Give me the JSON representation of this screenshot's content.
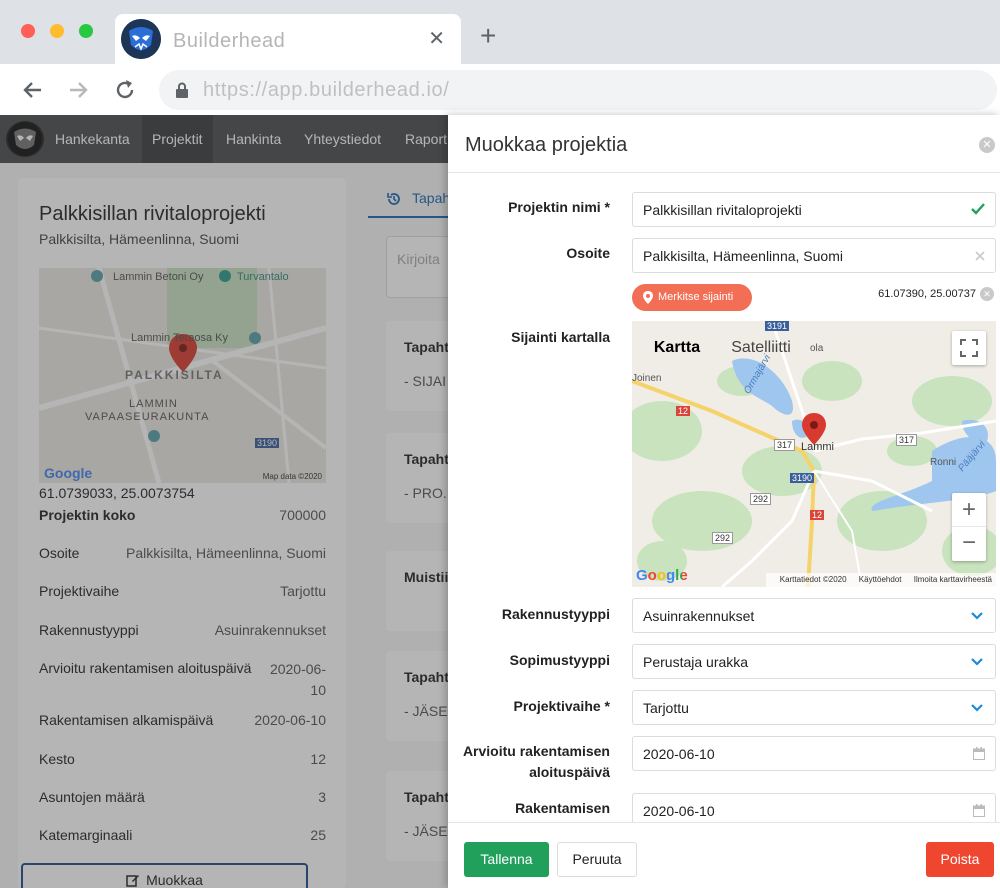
{
  "browser": {
    "tab_title": "Builderhead",
    "tab_close": "✕",
    "new_tab": "+",
    "url": "https://app.builderhead.io/"
  },
  "nav": {
    "items": [
      "Hankekanta",
      "Projektit",
      "Hankinta",
      "Yhteystiedot",
      "Raport"
    ],
    "active": "Projektit"
  },
  "left": {
    "title": "Palkkisillan rivitaloprojekti",
    "subtitle": "Palkkisilta, Hämeenlinna, Suomi",
    "map_labels": [
      "Lammin Betoni Oy",
      "Turvantalo",
      "Lammin Teraosa Ky",
      "PALKKISILTA",
      "LAMMIN",
      "VAPAASEURAKUNTA",
      "3190",
      "Map data ©2020",
      "Google"
    ],
    "coords": "61.0739033, 25.0073754",
    "details": [
      {
        "label": "Projektin koko",
        "value": "700000"
      },
      {
        "label": "Osoite",
        "value": "Palkkisilta, Hämeenlinna, Suomi"
      },
      {
        "label": "Projektivaihe",
        "value": "Tarjottu"
      },
      {
        "label": "Rakennustyyppi",
        "value": "Asuinrakennukset"
      },
      {
        "label": "Arvioitu rakentamisen aloituspäivä",
        "value": "2020-06-10"
      },
      {
        "label": "Rakentamisen alkamispäivä",
        "value": "2020-06-10"
      },
      {
        "label": "Kesto",
        "value": "12"
      },
      {
        "label": "Asuntojen määrä",
        "value": "3"
      },
      {
        "label": "Katemarginaali",
        "value": "25"
      }
    ],
    "edit_button": "Muokkaa"
  },
  "middle": {
    "tab_label": "Tapah",
    "input_placeholder": "Kirjoita",
    "cards": [
      {
        "title": "Tapaht",
        "sub": "- SIJAI"
      },
      {
        "title": "Tapaht",
        "sub": "- PRO..."
      },
      {
        "title": "Muistii",
        "sub": ""
      },
      {
        "title": "Tapaht",
        "sub": "- JÄSE"
      },
      {
        "title": "Tapaht",
        "sub": "- JÄSE"
      }
    ]
  },
  "panel": {
    "title": "Muokkaa projektia",
    "close": "✕",
    "fields": {
      "name_label": "Projektin nimi *",
      "name_value": "Palkkisillan rivitaloprojekti",
      "address_label": "Osoite",
      "address_value": "Palkkisilta, Hämeenlinna, Suomi",
      "marker_button": "Merkitse sijainti",
      "coords": "61.07390, 25.00737",
      "map_label": "Sijainti kartalla",
      "building_type_label": "Rakennustyyppi",
      "building_type_value": "Asuinrakennukset",
      "contract_type_label": "Sopimustyyppi",
      "contract_type_value": "Perustaja urakka",
      "phase_label": "Projektivaihe *",
      "phase_value": "Tarjottu",
      "est_start_label_1": "Arvioitu rakentamisen",
      "est_start_label_2": "aloituspäivä",
      "est_start_value": "2020-06-10",
      "start_label": "Rakentamisen",
      "start_value": "2020-06-10"
    },
    "map": {
      "type_map": "Kartta",
      "type_sat": "Satelliitti",
      "zoom_in": "+",
      "zoom_out": "−",
      "labels": [
        "3191",
        "Ormajärvi",
        "Joinen",
        "ola",
        "12",
        "317",
        "Lammi",
        "317",
        "Ronni",
        "Pääjärvi",
        "3190",
        "292",
        "12",
        "292",
        "Google"
      ],
      "footer": [
        "Karttatiedot ©2020",
        "Käyttöehdot",
        "Ilmoita karttavirheestä"
      ]
    },
    "buttons": {
      "save": "Tallenna",
      "cancel": "Peruuta",
      "delete": "Poista"
    }
  },
  "colors": {
    "save": "#21a05c",
    "delete": "#ef4630",
    "marker": "#f26e55",
    "nav": "#4a4d50"
  }
}
